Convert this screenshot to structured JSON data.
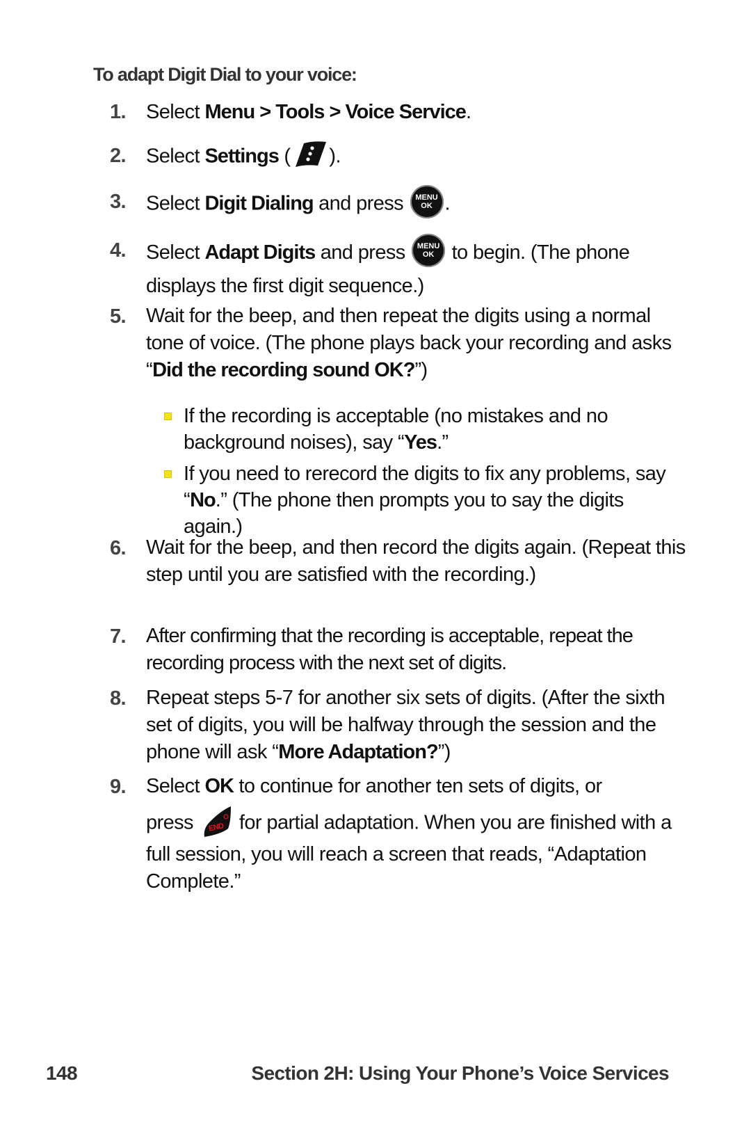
{
  "heading": "To adapt Digit Dial to your voice:",
  "steps": [
    {
      "number": "1.",
      "parts": {
        "a": "Select ",
        "b1": "Menu > Tools > Voice Service",
        "c": "."
      }
    },
    {
      "number": "2.",
      "parts": {
        "a": "Select ",
        "b1": "Settings",
        "c": " (",
        "icon": "settings-softkey-icon",
        "d": ")."
      }
    },
    {
      "number": "3.",
      "parts": {
        "a": "Select ",
        "b1": "Digit Dialing",
        "c": " and press ",
        "icon": "menu-ok-key-icon",
        "d": "."
      }
    },
    {
      "number": "4.",
      "parts": {
        "a": "Select ",
        "b1": "Adapt Digits",
        "c": " and press ",
        "icon": "menu-ok-key-icon",
        "d": " to begin. (The phone displays the first digit sequence.)"
      }
    },
    {
      "number": "5.",
      "parts": {
        "a": "Wait for the beep, and then repeat the digits using a normal tone of voice. (The phone plays back your recording and asks “",
        "b1": "Did the recording sound OK?",
        "c": "”)"
      },
      "bullets": [
        {
          "a": "If the recording is acceptable (no mistakes and no background noises), say “",
          "b": "Yes",
          "c": ".”"
        },
        {
          "a": "If you need to rerecord the digits to fix any problems, say “",
          "b": "No",
          "c": ".” (The phone then prompts you to say the digits again.)"
        }
      ]
    },
    {
      "number": "6.",
      "parts": {
        "a": "Wait for the beep, and then record the digits again. (Repeat this step until you are satisfied with the recording.)"
      }
    },
    {
      "number": "7.",
      "parts": {
        "a": "After confirming that the recording is acceptable, repeat the recording process with the next set of digits."
      }
    },
    {
      "number": "8.",
      "parts": {
        "a": "Repeat steps 5-7 for another six sets of digits. (After the sixth set of digits, you will be halfway through the session and the phone will ask “",
        "b1": "More Adaptation?",
        "c": "”)"
      }
    },
    {
      "number": "9.",
      "parts": {
        "a": "Select ",
        "b1": "OK",
        "c": " to continue for another ten sets of digits, or",
        "d": "press",
        "icon": "end-key-icon",
        "e": "for partial adaptation. When you are finished with a full session, you will reach a screen that reads, “Adaptation Complete.”"
      }
    }
  ],
  "icons": {
    "menu_ok_line1": "MENU",
    "menu_ok_line2": "OK",
    "end_label": "END"
  },
  "colors": {
    "bullet": "#f4e31a",
    "end_key_text": "#e0141e"
  },
  "footer": {
    "page_number": "148",
    "section_title": "Section 2H: Using Your Phone’s Voice Services"
  }
}
